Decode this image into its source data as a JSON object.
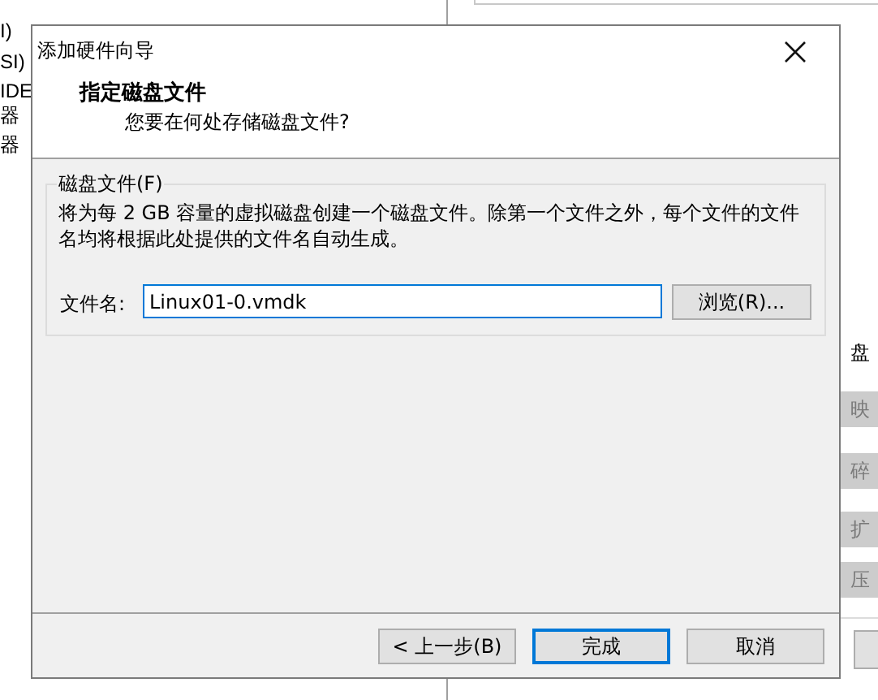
{
  "background": {
    "left_items": [
      "I)",
      "SI)",
      "IDE",
      "器",
      "器"
    ],
    "right_label": "盘",
    "right_buttons": [
      "映",
      "碎",
      "扩",
      "压"
    ]
  },
  "dialog": {
    "title": "添加硬件向导",
    "heading": "指定磁盘文件",
    "subheading": "您要在何处存储磁盘文件?",
    "group": {
      "label": "磁盘文件(F)",
      "description": "将为每 2 GB 容量的虚拟磁盘创建一个磁盘文件。除第一个文件之外，每个文件的文件名均将根据此处提供的文件名自动生成。",
      "filename_label": "文件名:",
      "filename_value": "Linux01-0.vmdk",
      "browse_button": "浏览(R)..."
    },
    "buttons": [
      {
        "label": "< 上一步(B)",
        "default": false
      },
      {
        "label": "完成",
        "default": true
      },
      {
        "label": "取消",
        "default": false
      }
    ]
  }
}
